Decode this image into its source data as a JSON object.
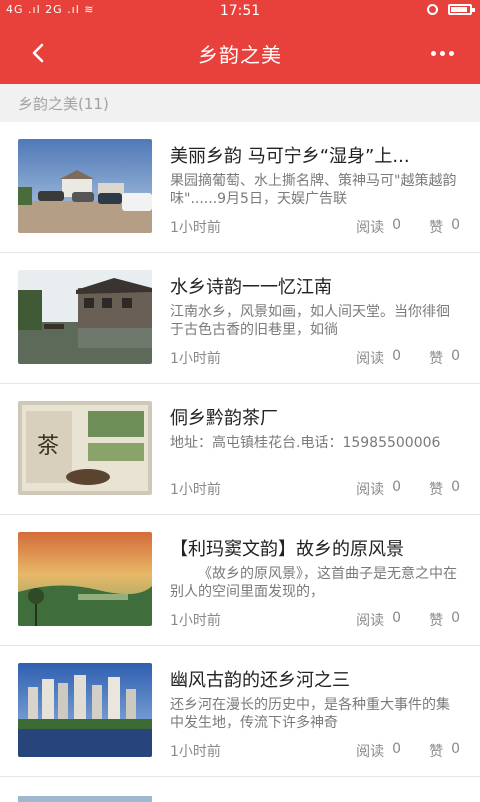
{
  "status_bar": {
    "time": "17:51",
    "left_text": "4G .ıl 2G .ıl ≋"
  },
  "header": {
    "title": "乡韵之美"
  },
  "section": {
    "title": "乡韵之美(11)"
  },
  "labels": {
    "read": "阅读",
    "like": "赞"
  },
  "items": [
    {
      "title": "美丽乡韵 马可宁乡“湿身”上...",
      "summary": "果园摘葡萄、水上撕名牌、策神马可\"越策越韵味\"......9月5日，天娱广告联",
      "time": "1小时前",
      "reads": "0",
      "likes": "0"
    },
    {
      "title": "水乡诗韵一一忆江南",
      "summary": "江南水乡，风景如画，如人间天堂。当你徘徊于古色古香的旧巷里，如徜",
      "time": "1小时前",
      "reads": "0",
      "likes": "0"
    },
    {
      "title": "侗乡黔韵茶厂",
      "summary": "地址：高屯镇桂花台.电话：15985500006",
      "time": "1小时前",
      "reads": "0",
      "likes": "0"
    },
    {
      "title": "【利玛窦文韵】故乡的原风景",
      "summary": "《故乡的原风景》，这首曲子是无意之中在别人的空间里面发现的，",
      "time": "1小时前",
      "reads": "0",
      "likes": "0"
    },
    {
      "title": "幽风古韵的还乡河之三",
      "summary": "还乡河在漫长的历史中，是各种重大事件的集中发生地，传流下许多神奇",
      "time": "1小时前",
      "reads": "0",
      "likes": "0"
    }
  ],
  "colors": {
    "brand": "#e8413c"
  }
}
